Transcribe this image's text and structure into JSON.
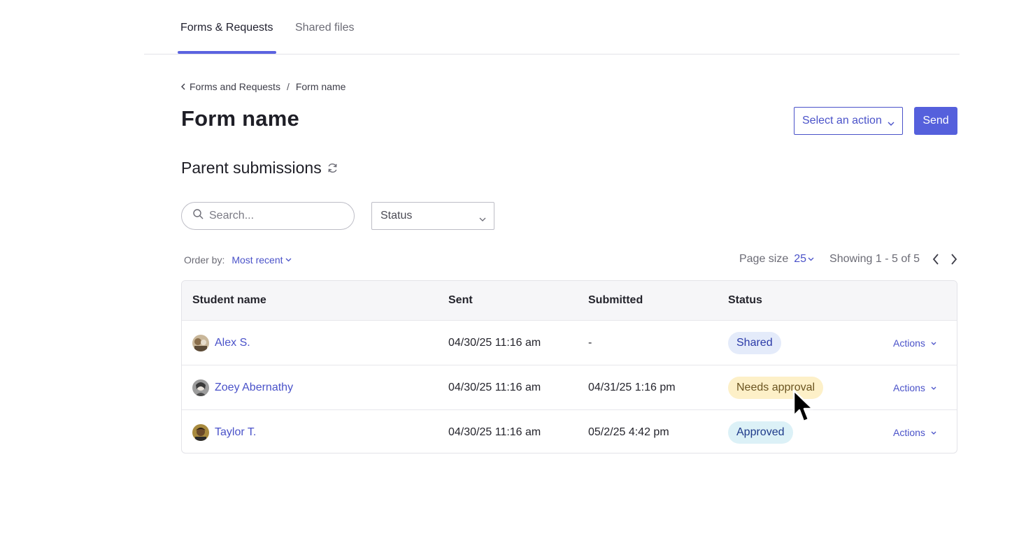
{
  "tabs": [
    {
      "label": "Forms & Requests",
      "active": true
    },
    {
      "label": "Shared files",
      "active": false
    }
  ],
  "breadcrumb": {
    "back_label": "Forms and Requests",
    "separator": "/",
    "current": "Form name"
  },
  "page_title": "Form name",
  "header_actions": {
    "select_label": "Select an action",
    "send_label": "Send"
  },
  "section": {
    "title": "Parent submissions"
  },
  "filters": {
    "search_placeholder": "Search...",
    "status_label": "Status"
  },
  "order": {
    "label": "Order by:",
    "value": "Most recent"
  },
  "pagination": {
    "page_size_label": "Page size",
    "page_size_value": "25",
    "showing": "Showing 1 - 5 of 5"
  },
  "table": {
    "columns": [
      "Student name",
      "Sent",
      "Submitted",
      "Status"
    ],
    "rows": [
      {
        "name": "Alex S.",
        "sent": "04/30/25  11:16 am",
        "submitted": "-",
        "status": "Shared",
        "status_kind": "shared",
        "action": "Actions"
      },
      {
        "name": "Zoey Abernathy",
        "sent": "04/30/25  11:16 am",
        "submitted": "04/31/25 1:16 pm",
        "status": "Needs approval",
        "status_kind": "needs",
        "action": "Actions"
      },
      {
        "name": "Taylor T.",
        "sent": "04/30/25  11:16 am",
        "submitted": "05/2/25 4:42 pm",
        "status": "Approved",
        "status_kind": "approved",
        "action": "Actions"
      }
    ]
  },
  "colors": {
    "accent": "#5b63e0",
    "link": "#4a52c9",
    "shared_bg": "#e4ebfa",
    "needs_bg": "#fdf0c8",
    "approved_bg": "#dcf1f7"
  }
}
